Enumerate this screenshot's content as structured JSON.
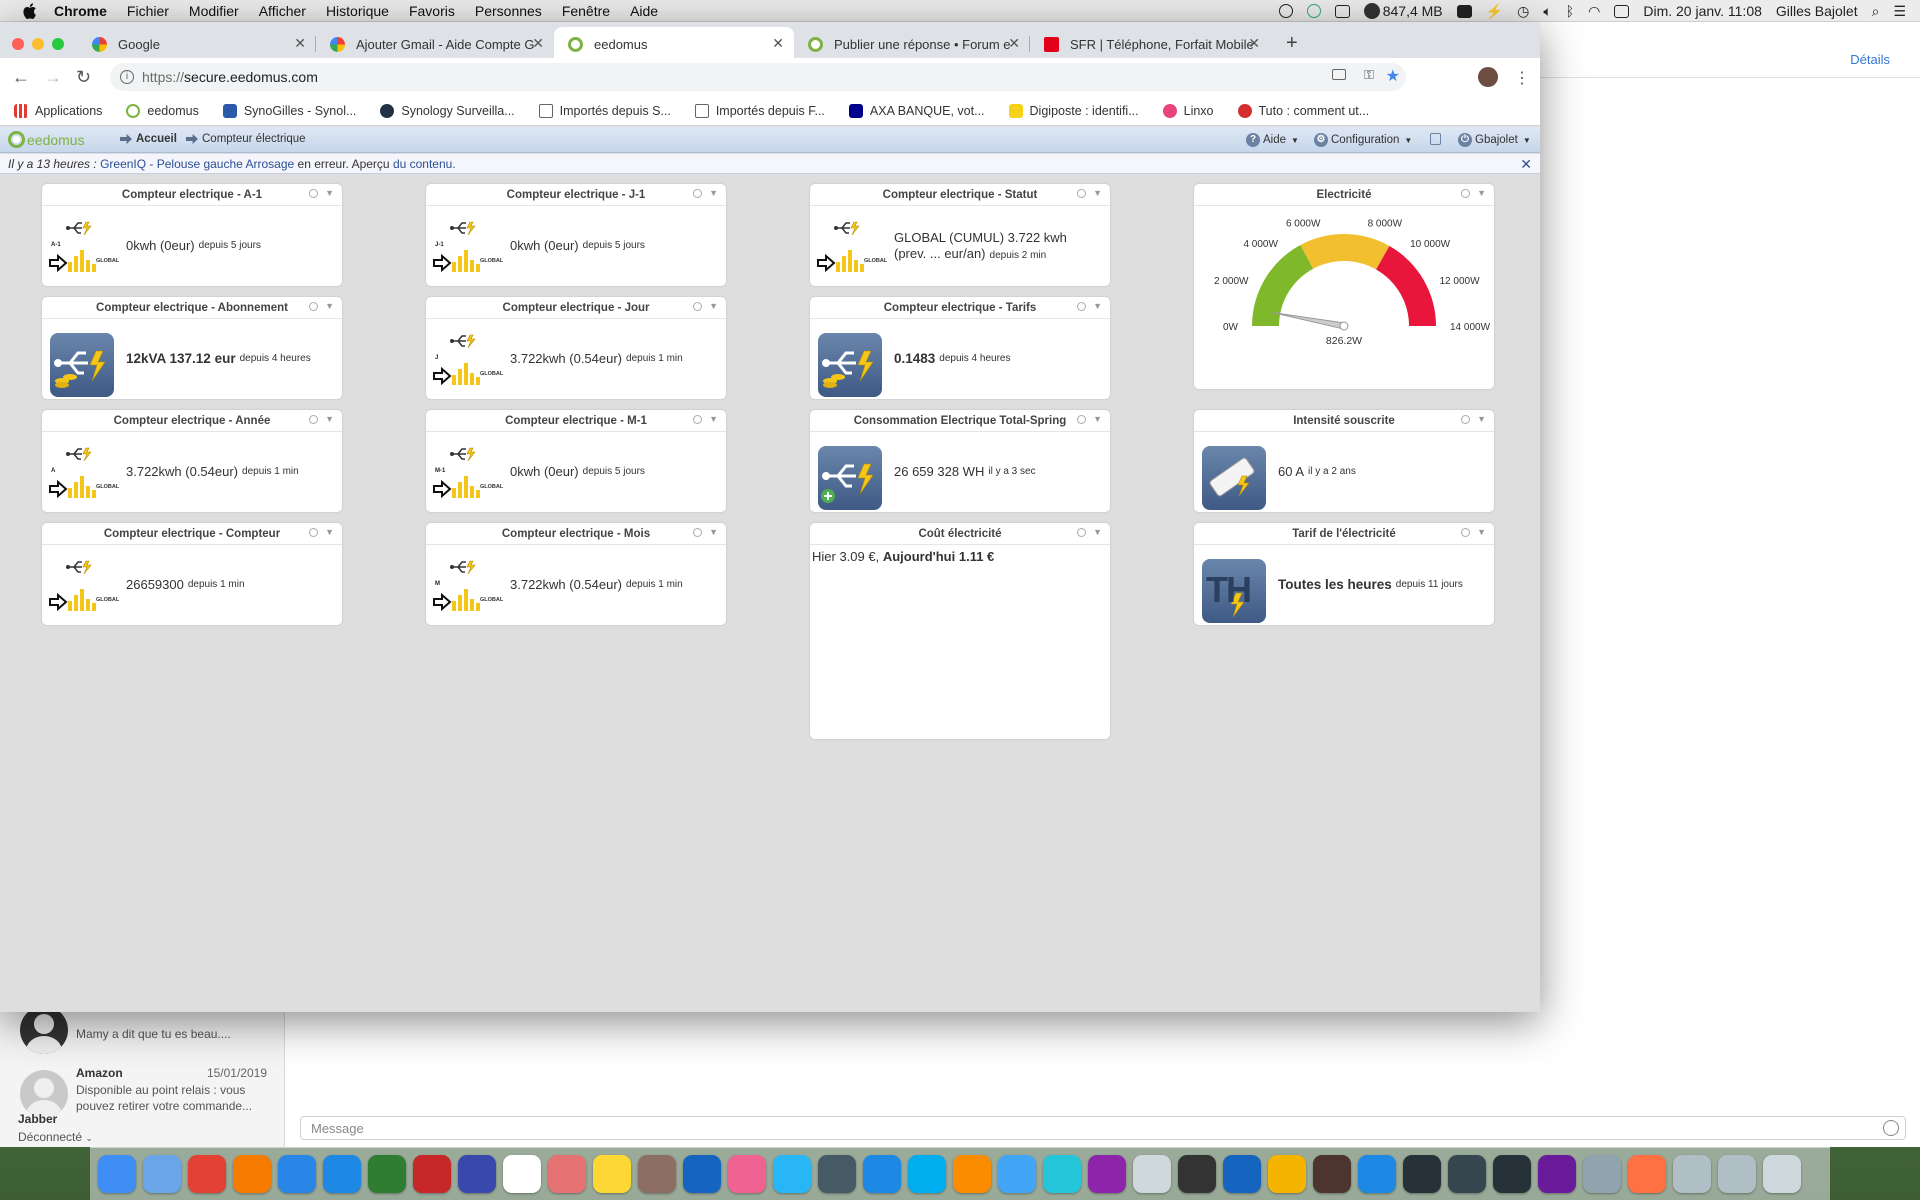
{
  "menubar": {
    "app": "Chrome",
    "items": [
      "Fichier",
      "Modifier",
      "Afficher",
      "Historique",
      "Favoris",
      "Personnes",
      "Fenêtre",
      "Aide"
    ],
    "memory": "847,4 MB",
    "datetime": "Dim. 20 janv.  11:08",
    "user": "Gilles Bajolet"
  },
  "background_app": {
    "details_link": "Détails",
    "conversations": [
      {
        "name": "",
        "date": "",
        "text": "Mamy a dit que tu es beau...."
      },
      {
        "name": "Amazon",
        "date": "15/01/2019",
        "text": "Disponible au point relais : vous pouvez retirer votre commande..."
      }
    ],
    "account": "Jabber",
    "status": "Déconnecté",
    "message_placeholder": "Message"
  },
  "browser": {
    "tabs": [
      {
        "title": "Google",
        "active": false
      },
      {
        "title": "Ajouter Gmail - Aide Compte G",
        "active": false
      },
      {
        "title": "eedomus",
        "active": true
      },
      {
        "title": "Publier une réponse • Forum e",
        "active": false
      },
      {
        "title": "SFR | Téléphone, Forfait Mobile",
        "active": false
      }
    ],
    "url_scheme": "https://",
    "url_host": "secure.eedomus.com",
    "bookmarks": [
      "Applications",
      "eedomus",
      "SynoGilles - Synol...",
      "Synology Surveilla...",
      "Importés depuis S...",
      "Importés depuis F...",
      "AXA BANQUE, vot...",
      "Digiposte : identifi...",
      "Linxo",
      "Tuto : comment ut..."
    ]
  },
  "eedomus": {
    "logo": "eedomus",
    "breadcrumb": [
      "Accueil",
      "Compteur électrique"
    ],
    "menu": {
      "help": "Aide",
      "config": "Configuration",
      "user": "Gbajolet"
    },
    "alert": {
      "prefix": "Il y a 13 heures :",
      "link1": "GreenIQ - Pelouse gauche Arrosage",
      "middle": "en erreur. Aperçu",
      "link2": "du contenu."
    },
    "widgets": {
      "a1": {
        "title": "Compteur electrique - A-1",
        "label": "A-1",
        "value": "0kwh (0eur)",
        "since": "depuis 5 jours"
      },
      "abo": {
        "title": "Compteur electrique - Abonnement",
        "value": "12kVA 137.12 eur",
        "since": "depuis 4 heures"
      },
      "annee": {
        "title": "Compteur electrique - Année",
        "label": "A",
        "value": "3.722kwh (0.54eur)",
        "since": "depuis 1 min"
      },
      "compteur": {
        "title": "Compteur electrique - Compteur",
        "label": "",
        "value": "26659300",
        "since": "depuis 1 min"
      },
      "j1": {
        "title": "Compteur electrique - J-1",
        "label": "J-1",
        "value": "0kwh (0eur)",
        "since": "depuis 5 jours"
      },
      "jour": {
        "title": "Compteur electrique - Jour",
        "label": "J",
        "value": "3.722kwh (0.54eur)",
        "since": "depuis 1 min"
      },
      "m1": {
        "title": "Compteur electrique - M-1",
        "label": "M-1",
        "value": "0kwh (0eur)",
        "since": "depuis 5 jours"
      },
      "mois": {
        "title": "Compteur electrique - Mois",
        "label": "M",
        "value": "3.722kwh (0.54eur)",
        "since": "depuis 1 min"
      },
      "statut": {
        "title": "Compteur electrique - Statut",
        "value": "GLOBAL (CUMUL) 3.722 kwh (prev. ... eur/an)",
        "since": "depuis 2 min"
      },
      "tarifs": {
        "title": "Compteur electrique - Tarifs",
        "value": "0.1483",
        "since": "depuis 4 heures"
      },
      "total": {
        "title": "Consommation Electrique Total-Spring",
        "value": "26 659 328 WH",
        "since": "il y a 3 sec"
      },
      "cout": {
        "title": "Coût électricité",
        "yesterday": "Hier 3.09 €,",
        "today": "Aujourd'hui 1.11 €"
      },
      "elec": {
        "title": "Electricité"
      },
      "intensite": {
        "title": "Intensité souscrite",
        "value": "60 A",
        "since": "il y a 2 ans"
      },
      "tarif_elec": {
        "title": "Tarif de l'électricité",
        "icon_text": "TH",
        "value": "Toutes les heures",
        "since": "depuis 11 jours"
      }
    },
    "global_label": "GLOBAL"
  },
  "gauge": {
    "min": 0,
    "max": 14000,
    "value": 826.2,
    "value_label": "826.2W",
    "tick_labels": [
      "0W",
      "2 000W",
      "4 000W",
      "6 000W",
      "8 000W",
      "10 000W",
      "12 000W",
      "14 000W"
    ],
    "bands": [
      {
        "from": 0,
        "to": 4800,
        "color": "#7fb92b"
      },
      {
        "from": 4800,
        "to": 9300,
        "color": "#f2c02f"
      },
      {
        "from": 9300,
        "to": 14000,
        "color": "#e8163a"
      }
    ]
  },
  "colors": {
    "accent_green": "#7cb342",
    "bar_yellow": "#f5c518",
    "link_blue": "#2c4f95"
  }
}
